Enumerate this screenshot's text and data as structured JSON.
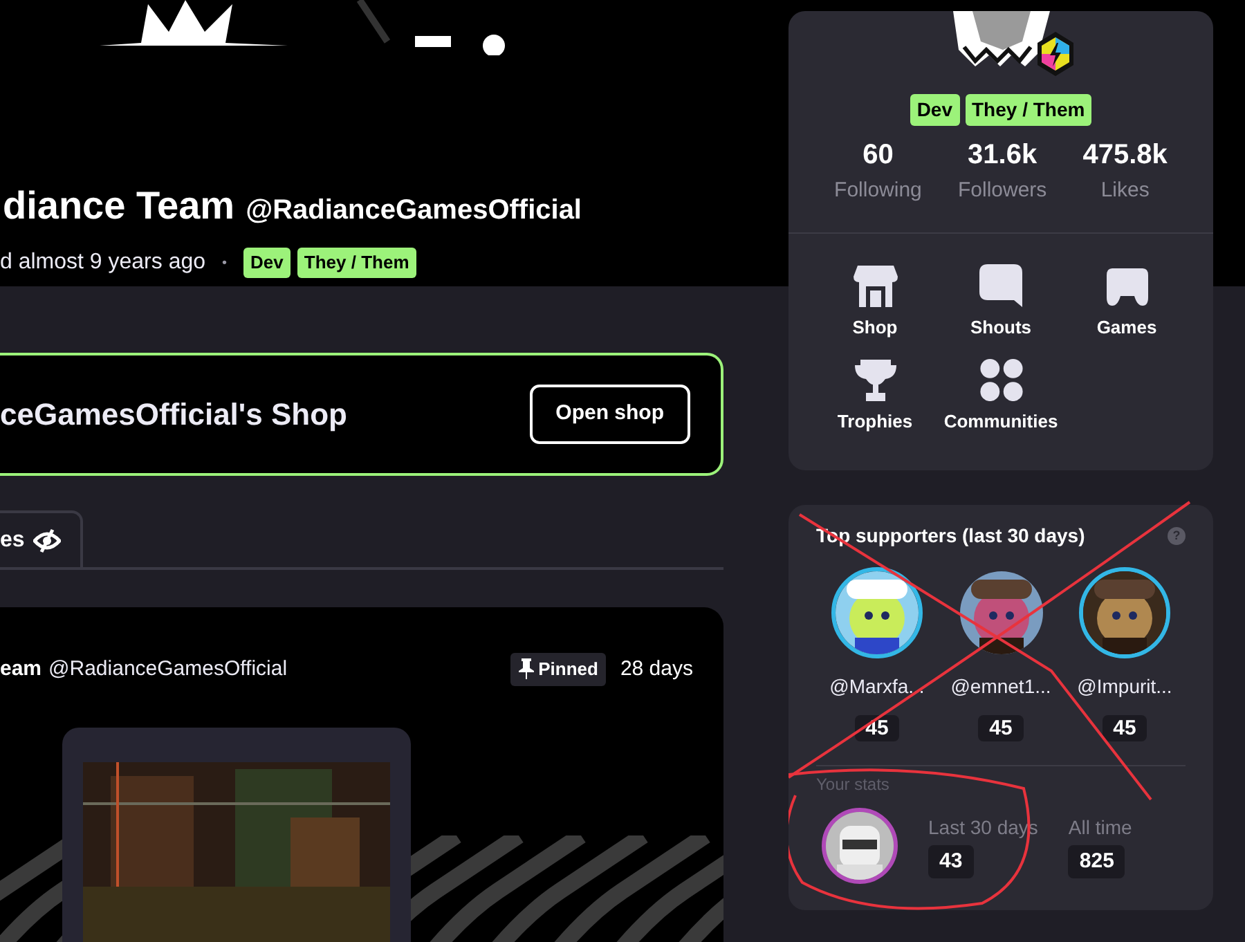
{
  "profile": {
    "name": "diance Team",
    "handle": "@RadianceGamesOfficial",
    "joined": "d almost 9 years ago",
    "separator": "•",
    "tags": [
      {
        "label": "Dev"
      },
      {
        "label": "They / Them"
      }
    ]
  },
  "shop_banner": {
    "title": "ceGamesOfficial's Shop",
    "button": "Open shop"
  },
  "tabs": [
    {
      "label": "es",
      "selected": true
    }
  ],
  "post": {
    "author": "eam",
    "handle": "@RadianceGamesOfficial",
    "pinned": "Pinned",
    "age": "28 days"
  },
  "side_card": {
    "tags": [
      {
        "label": "Dev"
      },
      {
        "label": "They / Them"
      }
    ],
    "stats": [
      {
        "value": "60",
        "label": "Following"
      },
      {
        "value": "31.6k",
        "label": "Followers"
      },
      {
        "value": "475.8k",
        "label": "Likes"
      }
    ],
    "links": [
      {
        "kind": "shop",
        "label": "Shop"
      },
      {
        "kind": "shouts",
        "label": "Shouts"
      },
      {
        "kind": "games",
        "label": "Games"
      },
      {
        "kind": "trophies",
        "label": "Trophies"
      },
      {
        "kind": "communities",
        "label": "Communities"
      }
    ]
  },
  "supporters": {
    "title": "Top supporters (last 30 days)",
    "help": "?",
    "items": [
      {
        "name": "@Marxfa...",
        "score": "45",
        "color": "#33b7e6"
      },
      {
        "name": "@emnet1...",
        "score": "45"
      },
      {
        "name": "@Impurit...",
        "score": "45",
        "color": "#33b7e6"
      }
    ],
    "your_stats_label": "Your stats",
    "your_stats": [
      {
        "label": "Last 30 days",
        "value": "43"
      },
      {
        "label": "All time",
        "value": "825"
      }
    ]
  }
}
